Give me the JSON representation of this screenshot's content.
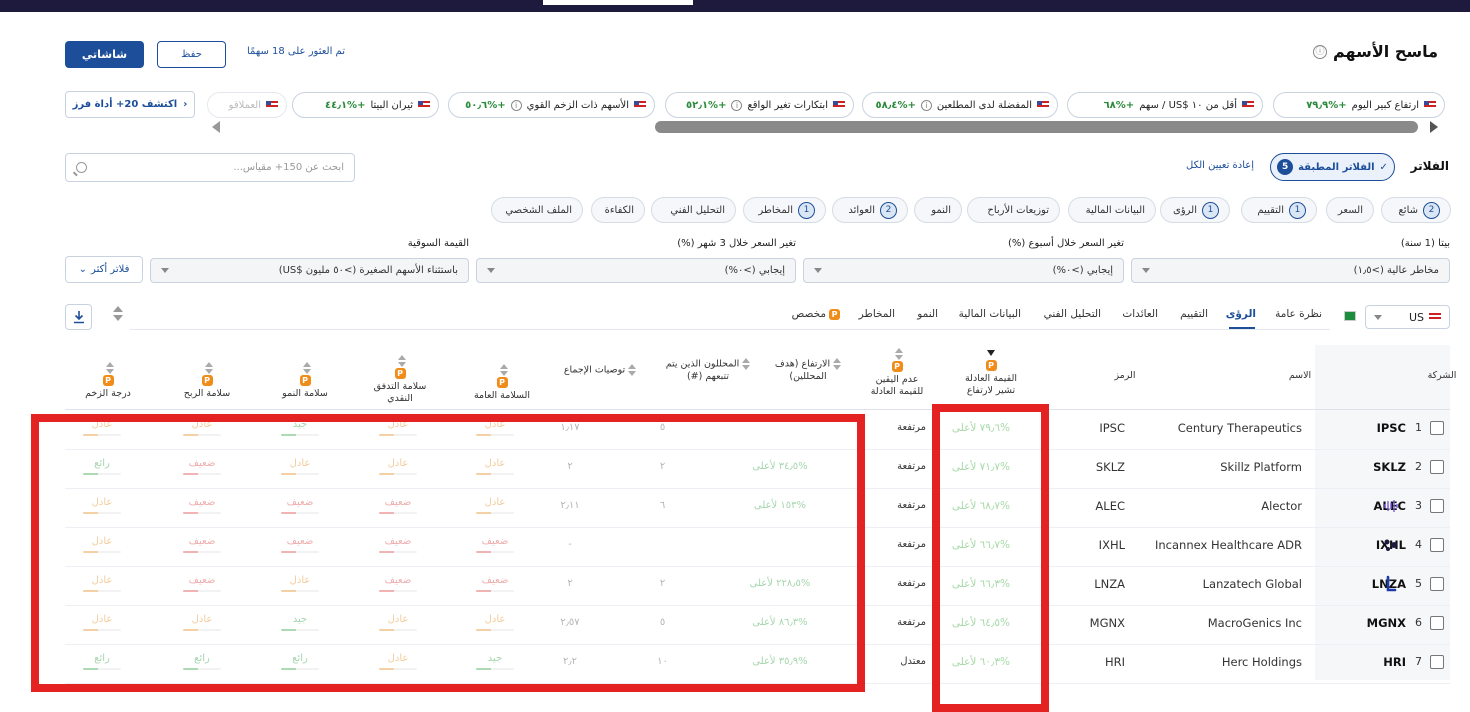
{
  "header": {
    "title": "ماسح الأسهم",
    "info_icon": "ⓘ",
    "primary_button": "شاشاتي",
    "save_button": "حفظ",
    "found_text": "تم العثور على 18 سهمًا"
  },
  "presets": [
    {
      "label": "ارتفاع كبير اليوم",
      "value": "+%٧٩٫٩"
    },
    {
      "label": "أقل من ١٠ $US / سهم",
      "value": "+%٦٨"
    },
    {
      "label": "المفضلة لدى المطلعين",
      "value": "+%٥٨٫٤"
    },
    {
      "label": "ابتكارات تغير الواقع",
      "value": "+%٥٢٫١"
    },
    {
      "label": "الأسهم ذات الزخم القوي",
      "value": "+%٥٠٫٦"
    },
    {
      "label": "ثيران البيتا",
      "value": "+%٤٤٫١"
    },
    {
      "label": "العملاقو",
      "value": ""
    }
  ],
  "explore_button": "اكتشف 20+ أداة فرز",
  "search_placeholder": "ابحث عن 150+ مقياس...",
  "filters": {
    "label": "الفلاتر",
    "applied_label": "الفلاتر المطبقة",
    "applied_count": "5",
    "reset_label": "إعادة تعيين الكل"
  },
  "categories": [
    {
      "label": "شائع",
      "count": "2"
    },
    {
      "label": "السعر",
      "count": ""
    },
    {
      "label": "التقييم",
      "count": "1"
    },
    {
      "label": "الرؤى",
      "count": "1"
    },
    {
      "label": "البيانات المالية",
      "count": ""
    },
    {
      "label": "توزيعات الأرباح",
      "count": ""
    },
    {
      "label": "النمو",
      "count": ""
    },
    {
      "label": "العوائد",
      "count": "2"
    },
    {
      "label": "المخاطر",
      "count": "1"
    },
    {
      "label": "التحليل الفني",
      "count": ""
    },
    {
      "label": "الكفاءة",
      "count": ""
    },
    {
      "label": "الملف الشخصي",
      "count": ""
    }
  ],
  "active_filters": [
    {
      "label": "بيتا (1 سنة)",
      "value": "مخاطر عالية (>١٫٥)"
    },
    {
      "label": "تغير السعر خلال أسبوع (%)",
      "value": "إيجابي (>٠%)"
    },
    {
      "label": "تغير السعر خلال 3 شهر (%)",
      "value": "إيجابي (>٠%)"
    },
    {
      "label": "القيمة السوقية",
      "value": "باستثناء الأسهم الصغيرة (>٥٠ مليون $US)"
    }
  ],
  "more_filters": "فلاتر أكثر",
  "region": "US",
  "tabs": [
    "نظرة عامة",
    "الرؤى",
    "التقييم",
    "العائدات",
    "التحليل الفني",
    "البيانات المالية",
    "النمو",
    "المخاطر",
    "مخصص"
  ],
  "columns": {
    "company": "الشركة",
    "name": "الاسم",
    "symbol": "الرمز",
    "fair_value": "القيمة العادلة تشير لارتفاع",
    "uncertainty": "عدم اليقين للقيمة العادلة",
    "upside": "الارتفاع (هدف المحللين)",
    "analysts": "المحللون الذين يتم تتبعهم (#)",
    "consensus": "توصيات الإجماع",
    "overall_health": "السلامة العامة",
    "cashflow_health": "سلامة التدفق النقدي",
    "growth_health": "سلامة النمو",
    "profit_health": "سلامة الربح",
    "momentum": "درجة الزخم"
  },
  "rows": [
    {
      "rank": "1",
      "ticker": "IPSC",
      "name": "Century Therapeutics",
      "symbol": "IPSC",
      "fv": "%٧٩٫٦ لأعلى",
      "unc": "مرتفعة",
      "upside": "",
      "analysts": "٥",
      "consensus": "١٫١٧",
      "overall": "عادل",
      "cash": "عادل",
      "growth": "جيد",
      "profit": "عادل",
      "momentum": "عادل"
    },
    {
      "rank": "2",
      "ticker": "SKLZ",
      "name": "Skillz Platform",
      "symbol": "SKLZ",
      "fv": "%٧١٫٧ لأعلى",
      "unc": "مرتفعة",
      "upside": "%٣٤٫٥ لأعلى",
      "analysts": "٢",
      "consensus": "٢",
      "overall": "عادل",
      "cash": "عادل",
      "growth": "عادل",
      "profit": "ضعيف",
      "momentum": "رائع"
    },
    {
      "rank": "3",
      "ticker": "ALEC",
      "name": "Alector",
      "symbol": "ALEC",
      "fv": "%٦٨٫٧ لأعلى",
      "unc": "مرتفعة",
      "upside": "%١٥٣ لأعلى",
      "analysts": "٦",
      "consensus": "٢٫١١",
      "overall": "عادل",
      "cash": "ضعيف",
      "growth": "ضعيف",
      "profit": "ضعيف",
      "momentum": "عادل"
    },
    {
      "rank": "4",
      "ticker": "IXHL",
      "name": "Incannex Healthcare ADR",
      "symbol": "IXHL",
      "fv": "%٦٦٫٧ لأعلى",
      "unc": "مرتفعة",
      "upside": "",
      "analysts": "",
      "consensus": "-",
      "overall": "ضعيف",
      "cash": "ضعيف",
      "growth": "ضعيف",
      "profit": "ضعيف",
      "momentum": "عادل"
    },
    {
      "rank": "5",
      "ticker": "LNZA",
      "name": "Lanzatech Global",
      "symbol": "LNZA",
      "fv": "%٦٦٫٣ لأعلى",
      "unc": "مرتفعة",
      "upside": "%٢٢٨٫٥ لأعلى",
      "analysts": "٢",
      "consensus": "٢",
      "overall": "ضعيف",
      "cash": "ضعيف",
      "growth": "عادل",
      "profit": "ضعيف",
      "momentum": "عادل"
    },
    {
      "rank": "6",
      "ticker": "MGNX",
      "name": "MacroGenics Inc",
      "symbol": "MGNX",
      "fv": "%٦٤٫٥ لأعلى",
      "unc": "مرتفعة",
      "upside": "%٨٦٫٣ لأعلى",
      "analysts": "٥",
      "consensus": "٢٫٥٧",
      "overall": "عادل",
      "cash": "عادل",
      "growth": "جيد",
      "profit": "عادل",
      "momentum": "عادل"
    },
    {
      "rank": "7",
      "ticker": "HRI",
      "name": "Herc Holdings",
      "symbol": "HRI",
      "fv": "%٦٠٫٣ لأعلى",
      "unc": "معتدل",
      "upside": "%٣٥٫٩ لأعلى",
      "analysts": "١٠",
      "consensus": "٢٫٢",
      "overall": "جيد",
      "cash": "عادل",
      "growth": "رائع",
      "profit": "رائع",
      "momentum": "رائع"
    }
  ],
  "colors": {
    "accent": "#1c4e9a",
    "highlight_box": "#e52222",
    "positive": "#5bb36a",
    "negative": "#e06a6a"
  }
}
